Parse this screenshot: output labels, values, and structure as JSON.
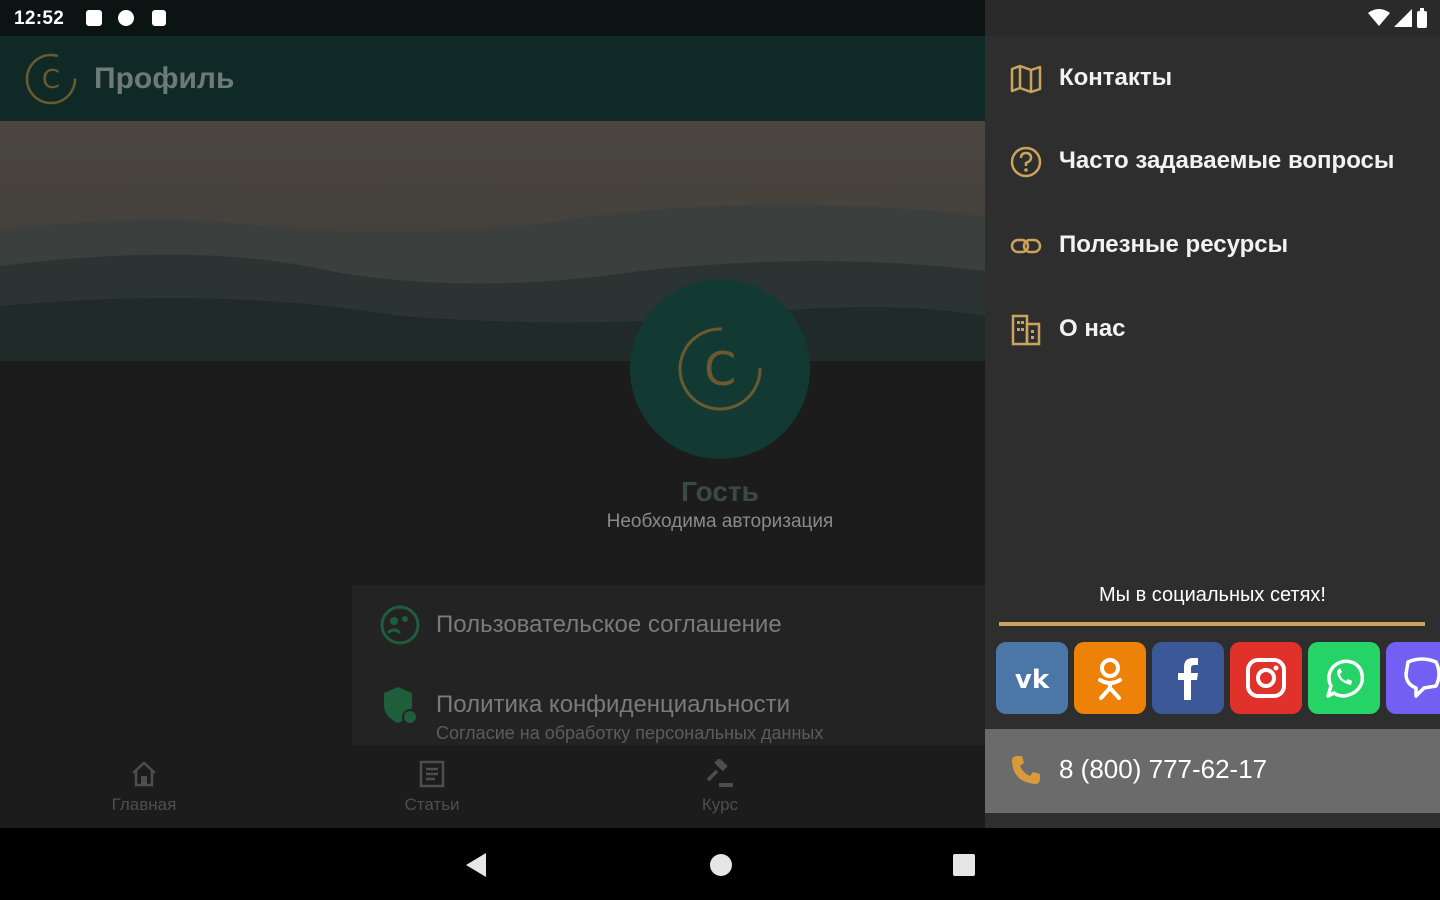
{
  "status_bar": {
    "time": "12:52"
  },
  "app_bar": {
    "title": "Профиль"
  },
  "profile": {
    "name": "Гость",
    "subtitle": "Необходима авторизация"
  },
  "policies": [
    {
      "title": "Пользовательское соглашение",
      "subtitle": ""
    },
    {
      "title": "Политика конфиденциальности",
      "subtitle": "Согласие на обработку персональных данных"
    }
  ],
  "bottom_nav": {
    "items": [
      {
        "label": "Главная",
        "icon": "home-icon"
      },
      {
        "label": "Статьи",
        "icon": "articles-icon"
      },
      {
        "label": "Курс",
        "icon": "gavel-icon"
      }
    ]
  },
  "drawer": {
    "menu": [
      {
        "label": "Контакты",
        "icon": "map-icon"
      },
      {
        "label": "Часто задаваемые вопросы",
        "icon": "help-circle-icon"
      },
      {
        "label": "Полезные ресурсы",
        "icon": "link-icon"
      },
      {
        "label": "О нас",
        "icon": "building-icon"
      }
    ],
    "social_title": "Мы в социальных сетях!",
    "socials": [
      {
        "name": "vk",
        "color": "#4a76a8"
      },
      {
        "name": "odnoklassniki",
        "color": "#ee8208"
      },
      {
        "name": "facebook",
        "color": "#3b5998"
      },
      {
        "name": "instagram",
        "color": "#e1306c"
      },
      {
        "name": "whatsapp",
        "color": "#25d366"
      },
      {
        "name": "viber",
        "color": "#7360f2"
      }
    ],
    "phone": "8 (800) 777-62-17"
  },
  "colors": {
    "accent_gold": "#c9a45a",
    "drawer_bg": "#2e2e2e",
    "app_bar": "#0f2a26"
  }
}
